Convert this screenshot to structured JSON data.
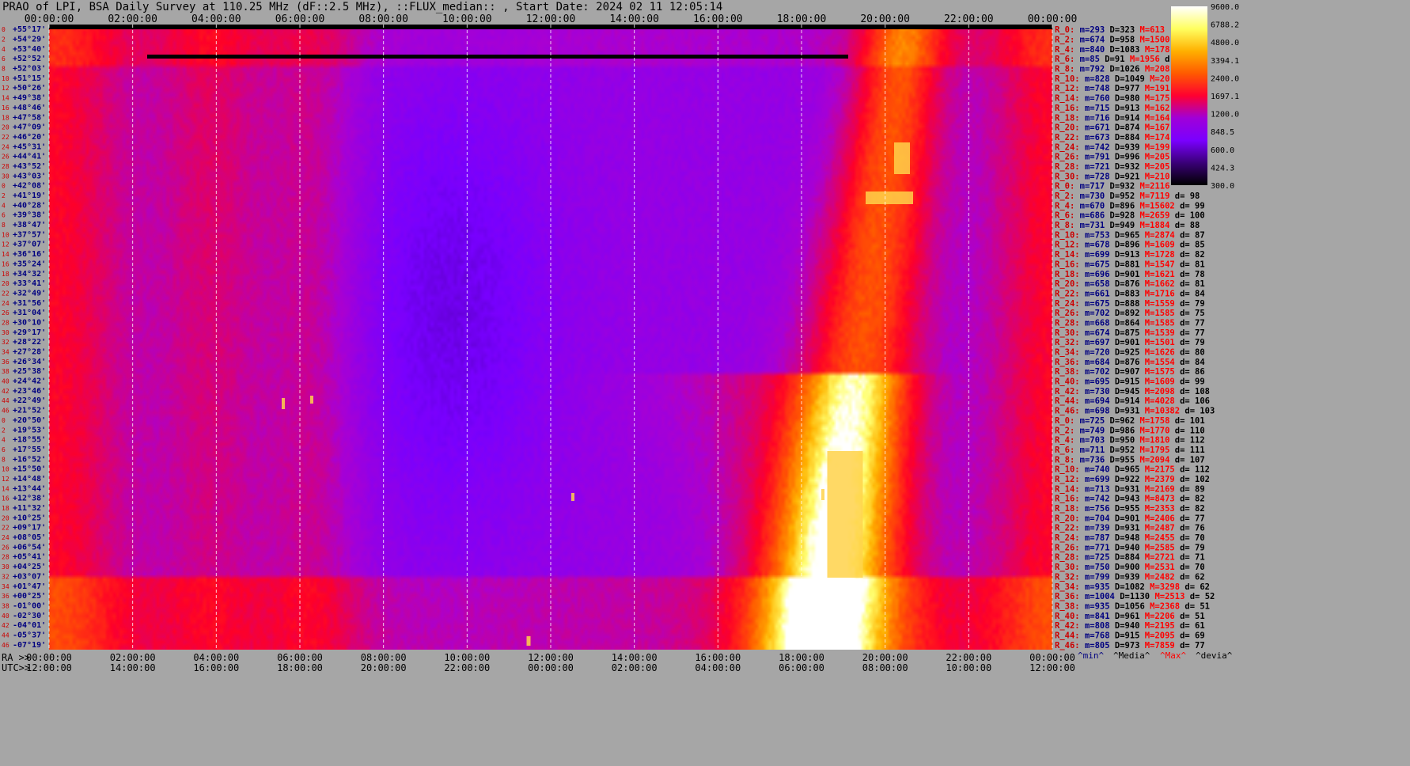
{
  "title": "PRAO of LPI, BSA Daily Survey at 110.25 MHz (dF::2.5 MHz), ::FLUX_median:: , Start Date: 2024 02 11 12:05:14",
  "chart_data": {
    "type": "heatmap",
    "title": "PRAO of LPI, BSA Daily Survey at 110.25 MHz (dF::2.5 MHz), ::FLUX_median:: , Start Date: 2024 02 11 12:05:14",
    "x_top_ticks": [
      "00:00:00",
      "02:00:00",
      "04:00:00",
      "06:00:00",
      "08:00:00",
      "10:00:00",
      "12:00:00",
      "14:00:00",
      "16:00:00",
      "18:00:00",
      "20:00:00",
      "22:00:00",
      "00:00:00"
    ],
    "x_bottom_ra_prefix": "RA >>",
    "x_bottom_ra_ticks": [
      "00:00:00",
      "02:00:00",
      "04:00:00",
      "06:00:00",
      "08:00:00",
      "10:00:00",
      "12:00:00",
      "14:00:00",
      "16:00:00",
      "18:00:00",
      "20:00:00",
      "22:00:00",
      "00:00:00"
    ],
    "x_bottom_utc_prefix": "UTC>>",
    "x_bottom_utc_ticks": [
      "12:00:00",
      "14:00:00",
      "16:00:00",
      "18:00:00",
      "20:00:00",
      "22:00:00",
      "00:00:00",
      "02:00:00",
      "04:00:00",
      "06:00:00",
      "08:00:00",
      "10:00:00",
      "12:00:00"
    ],
    "row_numbers": [
      "0",
      "2",
      "4",
      "6",
      "8",
      "10",
      "12",
      "14",
      "16",
      "18",
      "20",
      "22",
      "24",
      "26",
      "28",
      "30",
      "0",
      "2",
      "4",
      "6",
      "8",
      "10",
      "12",
      "14",
      "16",
      "18",
      "20",
      "22",
      "24",
      "26",
      "28",
      "30",
      "32",
      "34",
      "36",
      "38",
      "40",
      "42",
      "44",
      "46",
      "0",
      "2",
      "4",
      "6",
      "8",
      "10",
      "12",
      "14",
      "16",
      "18",
      "20",
      "22",
      "24",
      "26",
      "28",
      "30",
      "32",
      "34",
      "36",
      "38",
      "40",
      "42",
      "44",
      "46"
    ],
    "declination_labels": [
      "+55°17'",
      "+54°29'",
      "+53°40'",
      "+52°52'",
      "+52°03'",
      "+51°15'",
      "+50°26'",
      "+49°38'",
      "+48°46'",
      "+47°58'",
      "+47°09'",
      "+46°20'",
      "+45°31'",
      "+44°41'",
      "+43°52'",
      "+43°03'",
      "+42°08'",
      "+41°19'",
      "+40°28'",
      "+39°38'",
      "+38°47'",
      "+37°57'",
      "+37°07'",
      "+36°16'",
      "+35°24'",
      "+34°32'",
      "+33°41'",
      "+32°49'",
      "+31°56'",
      "+31°04'",
      "+30°10'",
      "+29°17'",
      "+28°22'",
      "+27°28'",
      "+26°34'",
      "+25°38'",
      "+24°42'",
      "+23°46'",
      "+22°49'",
      "+21°52'",
      "+20°50'",
      "+19°53'",
      "+18°55'",
      "+17°55'",
      "+16°52'",
      "+15°50'",
      "+14°48'",
      "+13°44'",
      "+12°38'",
      "+11°32'",
      "+10°25'",
      "+09°17'",
      "+08°05'",
      "+06°54'",
      "+05°41'",
      "+04°25'",
      "+03°07'",
      "+01°47'",
      "+00°25'",
      "-01°00'",
      "-02°30'",
      "-04°01'",
      "-05°37'",
      "-07°19'"
    ],
    "stats": [
      {
        "r": "R_0:",
        "m": "m=293",
        "D": "D=323",
        "M": "M=613",
        "d": ""
      },
      {
        "r": "R_2:",
        "m": "m=674",
        "D": "D=958",
        "M": "M=1500",
        "d": ""
      },
      {
        "r": "R_4:",
        "m": "m=840",
        "D": "D=1083",
        "M": "M=178",
        "d": ""
      },
      {
        "r": "R_6:",
        "m": "m=85",
        "D": "D=91",
        "M": "M=1956",
        "d": "d"
      },
      {
        "r": "R_8:",
        "m": "m=792",
        "D": "D=1026",
        "M": "M=208",
        "d": ""
      },
      {
        "r": "R_10:",
        "m": "m=828",
        "D": "D=1049",
        "M": "M=20",
        "d": ""
      },
      {
        "r": "R_12:",
        "m": "m=748",
        "D": "D=977",
        "M": "M=191",
        "d": ""
      },
      {
        "r": "R_14:",
        "m": "m=760",
        "D": "D=980",
        "M": "M=175",
        "d": ""
      },
      {
        "r": "R_16:",
        "m": "m=715",
        "D": "D=913",
        "M": "M=162",
        "d": ""
      },
      {
        "r": "R_18:",
        "m": "m=716",
        "D": "D=914",
        "M": "M=164",
        "d": ""
      },
      {
        "r": "R_20:",
        "m": "m=671",
        "D": "D=874",
        "M": "M=167",
        "d": ""
      },
      {
        "r": "R_22:",
        "m": "m=673",
        "D": "D=884",
        "M": "M=174",
        "d": ""
      },
      {
        "r": "R_24:",
        "m": "m=742",
        "D": "D=939",
        "M": "M=199",
        "d": ""
      },
      {
        "r": "R_26:",
        "m": "m=791",
        "D": "D=996",
        "M": "M=205",
        "d": ""
      },
      {
        "r": "R_28:",
        "m": "m=721",
        "D": "D=932",
        "M": "M=205",
        "d": ""
      },
      {
        "r": "R_30:",
        "m": "m=728",
        "D": "D=921",
        "M": "M=210",
        "d": ""
      },
      {
        "r": "R_0:",
        "m": "m=717",
        "D": "D=932",
        "M": "M=2116",
        "d": ""
      },
      {
        "r": "R_2:",
        "m": "m=730",
        "D": "D=952",
        "M": "M=7119",
        "d": "d= 98"
      },
      {
        "r": "R_4:",
        "m": "m=670",
        "D": "D=896",
        "M": "M=15602",
        "d": "d= 99"
      },
      {
        "r": "R_6:",
        "m": "m=686",
        "D": "D=928",
        "M": "M=2659",
        "d": "d= 100"
      },
      {
        "r": "R_8:",
        "m": "m=731",
        "D": "D=949",
        "M": "M=1884",
        "d": "d= 88"
      },
      {
        "r": "R_10:",
        "m": "m=753",
        "D": "D=965",
        "M": "M=2874",
        "d": "d= 87"
      },
      {
        "r": "R_12:",
        "m": "m=678",
        "D": "D=896",
        "M": "M=1609",
        "d": "d= 85"
      },
      {
        "r": "R_14:",
        "m": "m=699",
        "D": "D=913",
        "M": "M=1728",
        "d": "d= 82"
      },
      {
        "r": "R_16:",
        "m": "m=675",
        "D": "D=881",
        "M": "M=1547",
        "d": "d= 81"
      },
      {
        "r": "R_18:",
        "m": "m=696",
        "D": "D=901",
        "M": "M=1621",
        "d": "d= 78"
      },
      {
        "r": "R_20:",
        "m": "m=658",
        "D": "D=876",
        "M": "M=1662",
        "d": "d= 81"
      },
      {
        "r": "R_22:",
        "m": "m=661",
        "D": "D=883",
        "M": "M=1716",
        "d": "d= 84"
      },
      {
        "r": "R_24:",
        "m": "m=675",
        "D": "D=888",
        "M": "M=1559",
        "d": "d= 79"
      },
      {
        "r": "R_26:",
        "m": "m=702",
        "D": "D=892",
        "M": "M=1585",
        "d": "d= 75"
      },
      {
        "r": "R_28:",
        "m": "m=668",
        "D": "D=864",
        "M": "M=1585",
        "d": "d= 77"
      },
      {
        "r": "R_30:",
        "m": "m=674",
        "D": "D=875",
        "M": "M=1539",
        "d": "d= 77"
      },
      {
        "r": "R_32:",
        "m": "m=697",
        "D": "D=901",
        "M": "M=1501",
        "d": "d= 79"
      },
      {
        "r": "R_34:",
        "m": "m=720",
        "D": "D=925",
        "M": "M=1626",
        "d": "d= 80"
      },
      {
        "r": "R_36:",
        "m": "m=684",
        "D": "D=876",
        "M": "M=1554",
        "d": "d= 84"
      },
      {
        "r": "R_38:",
        "m": "m=702",
        "D": "D=907",
        "M": "M=1575",
        "d": "d= 86"
      },
      {
        "r": "R_40:",
        "m": "m=695",
        "D": "D=915",
        "M": "M=1609",
        "d": "d= 99"
      },
      {
        "r": "R_42:",
        "m": "m=730",
        "D": "D=945",
        "M": "M=2098",
        "d": "d= 108"
      },
      {
        "r": "R_44:",
        "m": "m=694",
        "D": "D=914",
        "M": "M=4028",
        "d": "d= 106"
      },
      {
        "r": "R_46:",
        "m": "m=698",
        "D": "D=931",
        "M": "M=10382",
        "d": "d= 103"
      },
      {
        "r": "R_0:",
        "m": "m=725",
        "D": "D=962",
        "M": "M=1758",
        "d": "d= 101"
      },
      {
        "r": "R_2:",
        "m": "m=749",
        "D": "D=986",
        "M": "M=1770",
        "d": "d= 110"
      },
      {
        "r": "R_4:",
        "m": "m=703",
        "D": "D=950",
        "M": "M=1810",
        "d": "d= 112"
      },
      {
        "r": "R_6:",
        "m": "m=711",
        "D": "D=952",
        "M": "M=1795",
        "d": "d= 111"
      },
      {
        "r": "R_8:",
        "m": "m=736",
        "D": "D=955",
        "M": "M=2094",
        "d": "d= 107"
      },
      {
        "r": "R_10:",
        "m": "m=740",
        "D": "D=965",
        "M": "M=2175",
        "d": "d= 112"
      },
      {
        "r": "R_12:",
        "m": "m=699",
        "D": "D=922",
        "M": "M=2379",
        "d": "d= 102"
      },
      {
        "r": "R_14:",
        "m": "m=713",
        "D": "D=931",
        "M": "M=2169",
        "d": "d= 89"
      },
      {
        "r": "R_16:",
        "m": "m=742",
        "D": "D=943",
        "M": "M=8473",
        "d": "d= 82"
      },
      {
        "r": "R_18:",
        "m": "m=756",
        "D": "D=955",
        "M": "M=2353",
        "d": "d= 82"
      },
      {
        "r": "R_20:",
        "m": "m=704",
        "D": "D=901",
        "M": "M=2406",
        "d": "d= 77"
      },
      {
        "r": "R_22:",
        "m": "m=739",
        "D": "D=931",
        "M": "M=2487",
        "d": "d= 76"
      },
      {
        "r": "R_24:",
        "m": "m=787",
        "D": "D=948",
        "M": "M=2455",
        "d": "d= 70"
      },
      {
        "r": "R_26:",
        "m": "m=771",
        "D": "D=940",
        "M": "M=2585",
        "d": "d= 79"
      },
      {
        "r": "R_28:",
        "m": "m=725",
        "D": "D=884",
        "M": "M=2721",
        "d": "d= 71"
      },
      {
        "r": "R_30:",
        "m": "m=750",
        "D": "D=900",
        "M": "M=2531",
        "d": "d= 70"
      },
      {
        "r": "R_32:",
        "m": "m=799",
        "D": "D=939",
        "M": "M=2482",
        "d": "d= 62"
      },
      {
        "r": "R_34:",
        "m": "m=935",
        "D": "D=1082",
        "M": "M=3298",
        "d": "d= 62"
      },
      {
        "r": "R_36:",
        "m": "m=1004",
        "D": "D=1130",
        "M": "M=2513",
        "d": "d= 52"
      },
      {
        "r": "R_38:",
        "m": "m=935",
        "D": "D=1056",
        "M": "M=2368",
        "d": "d= 51"
      },
      {
        "r": "R_40:",
        "m": "m=841",
        "D": "D=961",
        "M": "M=2206",
        "d": "d= 51"
      },
      {
        "r": "R_42:",
        "m": "m=808",
        "D": "D=940",
        "M": "M=2195",
        "d": "d= 61"
      },
      {
        "r": "R_44:",
        "m": "m=768",
        "D": "D=915",
        "M": "M=2095",
        "d": "d= 69"
      },
      {
        "r": "R_46:",
        "m": "m=805",
        "D": "D=973",
        "M": "M=7859",
        "d": "d= 77"
      }
    ],
    "stats_legend": [
      "^min^",
      "^Media^",
      "^Max^",
      "^devia^"
    ],
    "colorbar": {
      "labels": [
        "9600.0",
        "6788.2",
        "4800.0",
        "3394.1",
        "2400.0",
        "1697.1",
        "1200.0",
        "848.5",
        "600.0",
        "424.3",
        "300.0"
      ],
      "stops": [
        "#000000",
        "#3a0078",
        "#7a00ff",
        "#a000d8",
        "#ff0030",
        "#ff5a00",
        "#ffb000",
        "#ffff60",
        "#ffffff"
      ]
    },
    "colors": {
      "stat_row": "#cc0000",
      "stat_min": "#000080",
      "stat_median": "#000000",
      "stat_max": "#ff0000",
      "stat_dev": "#000000",
      "row_number": "#cc0000",
      "declination": "#000080",
      "background": "#a6a6a6"
    }
  }
}
